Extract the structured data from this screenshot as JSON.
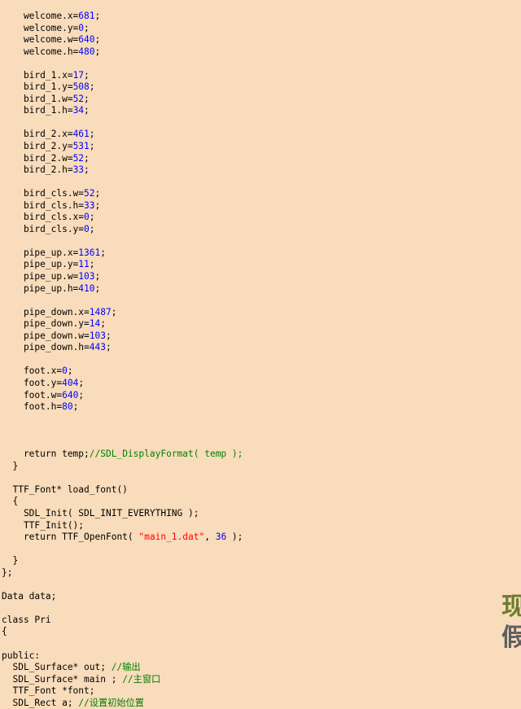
{
  "colors": {
    "background": "#f8dcbb",
    "text": "#000000",
    "number": "#0000ff",
    "string": "#ff0000",
    "comment": "#008000"
  },
  "code_lines": [
    [
      {
        "t": "    welcome.x="
      },
      {
        "t": "681",
        "k": "num"
      },
      {
        "t": ";"
      }
    ],
    [
      {
        "t": "    welcome.y="
      },
      {
        "t": "0",
        "k": "num"
      },
      {
        "t": ";"
      }
    ],
    [
      {
        "t": "    welcome.w="
      },
      {
        "t": "640",
        "k": "num"
      },
      {
        "t": ";"
      }
    ],
    [
      {
        "t": "    welcome.h="
      },
      {
        "t": "480",
        "k": "num"
      },
      {
        "t": ";"
      }
    ],
    [],
    [
      {
        "t": "    bird_1.x="
      },
      {
        "t": "17",
        "k": "num"
      },
      {
        "t": ";"
      }
    ],
    [
      {
        "t": "    bird_1.y="
      },
      {
        "t": "508",
        "k": "num"
      },
      {
        "t": ";"
      }
    ],
    [
      {
        "t": "    bird_1.w="
      },
      {
        "t": "52",
        "k": "num"
      },
      {
        "t": ";"
      }
    ],
    [
      {
        "t": "    bird_1.h="
      },
      {
        "t": "34",
        "k": "num"
      },
      {
        "t": ";"
      }
    ],
    [],
    [
      {
        "t": "    bird_2.x="
      },
      {
        "t": "461",
        "k": "num"
      },
      {
        "t": ";"
      }
    ],
    [
      {
        "t": "    bird_2.y="
      },
      {
        "t": "531",
        "k": "num"
      },
      {
        "t": ";"
      }
    ],
    [
      {
        "t": "    bird_2.w="
      },
      {
        "t": "52",
        "k": "num"
      },
      {
        "t": ";"
      }
    ],
    [
      {
        "t": "    bird_2.h="
      },
      {
        "t": "33",
        "k": "num"
      },
      {
        "t": ";"
      }
    ],
    [],
    [
      {
        "t": "    bird_cls.w="
      },
      {
        "t": "52",
        "k": "num"
      },
      {
        "t": ";"
      }
    ],
    [
      {
        "t": "    bird_cls.h="
      },
      {
        "t": "33",
        "k": "num"
      },
      {
        "t": ";"
      }
    ],
    [
      {
        "t": "    bird_cls.x="
      },
      {
        "t": "0",
        "k": "num"
      },
      {
        "t": ";"
      }
    ],
    [
      {
        "t": "    bird_cls.y="
      },
      {
        "t": "0",
        "k": "num"
      },
      {
        "t": ";"
      }
    ],
    [],
    [
      {
        "t": "    pipe_up.x="
      },
      {
        "t": "1361",
        "k": "num"
      },
      {
        "t": ";"
      }
    ],
    [
      {
        "t": "    pipe_up.y="
      },
      {
        "t": "11",
        "k": "num"
      },
      {
        "t": ";"
      }
    ],
    [
      {
        "t": "    pipe_up.w="
      },
      {
        "t": "103",
        "k": "num"
      },
      {
        "t": ";"
      }
    ],
    [
      {
        "t": "    pipe_up.h="
      },
      {
        "t": "410",
        "k": "num"
      },
      {
        "t": ";"
      }
    ],
    [],
    [
      {
        "t": "    pipe_down.x="
      },
      {
        "t": "1487",
        "k": "num"
      },
      {
        "t": ";"
      }
    ],
    [
      {
        "t": "    pipe_down.y="
      },
      {
        "t": "14",
        "k": "num"
      },
      {
        "t": ";"
      }
    ],
    [
      {
        "t": "    pipe_down.w="
      },
      {
        "t": "103",
        "k": "num"
      },
      {
        "t": ";"
      }
    ],
    [
      {
        "t": "    pipe_down.h="
      },
      {
        "t": "443",
        "k": "num"
      },
      {
        "t": ";"
      }
    ],
    [],
    [
      {
        "t": "    foot.x="
      },
      {
        "t": "0",
        "k": "num"
      },
      {
        "t": ";"
      }
    ],
    [
      {
        "t": "    foot.y="
      },
      {
        "t": "404",
        "k": "num"
      },
      {
        "t": ";"
      }
    ],
    [
      {
        "t": "    foot.w="
      },
      {
        "t": "640",
        "k": "num"
      },
      {
        "t": ";"
      }
    ],
    [
      {
        "t": "    foot.h="
      },
      {
        "t": "80",
        "k": "num"
      },
      {
        "t": ";"
      }
    ],
    [],
    [],
    [],
    [
      {
        "t": "    return temp;"
      },
      {
        "t": "//SDL_DisplayFormat( temp );",
        "k": "com"
      }
    ],
    [
      {
        "t": "  }"
      }
    ],
    [],
    [
      {
        "t": "  TTF_Font* load_font()"
      }
    ],
    [
      {
        "t": "  {"
      }
    ],
    [
      {
        "t": "    SDL_Init( SDL_INIT_EVERYTHING );"
      }
    ],
    [
      {
        "t": "    TTF_Init();"
      }
    ],
    [
      {
        "t": "    return TTF_OpenFont( "
      },
      {
        "t": "\"main_1.dat\"",
        "k": "str"
      },
      {
        "t": ", "
      },
      {
        "t": "36",
        "k": "num"
      },
      {
        "t": " );"
      }
    ],
    [],
    [
      {
        "t": "  }"
      }
    ],
    [
      {
        "t": "};"
      }
    ],
    [],
    [
      {
        "t": "Data data;"
      }
    ],
    [],
    [
      {
        "t": "class Pri"
      }
    ],
    [
      {
        "t": "{"
      }
    ],
    [],
    [
      {
        "t": "public:"
      }
    ],
    [
      {
        "t": "  SDL_Surface* out; "
      },
      {
        "t": "//输出",
        "k": "com"
      }
    ],
    [
      {
        "t": "  SDL_Surface* main ; "
      },
      {
        "t": "//主窗口",
        "k": "com"
      }
    ],
    [
      {
        "t": "  TTF_Font *font;"
      }
    ],
    [
      {
        "t": "  SDL_Rect a; "
      },
      {
        "t": "//设置初始位置",
        "k": "com"
      }
    ]
  ],
  "side_text": {
    "line1": "现",
    "line2": "假"
  }
}
